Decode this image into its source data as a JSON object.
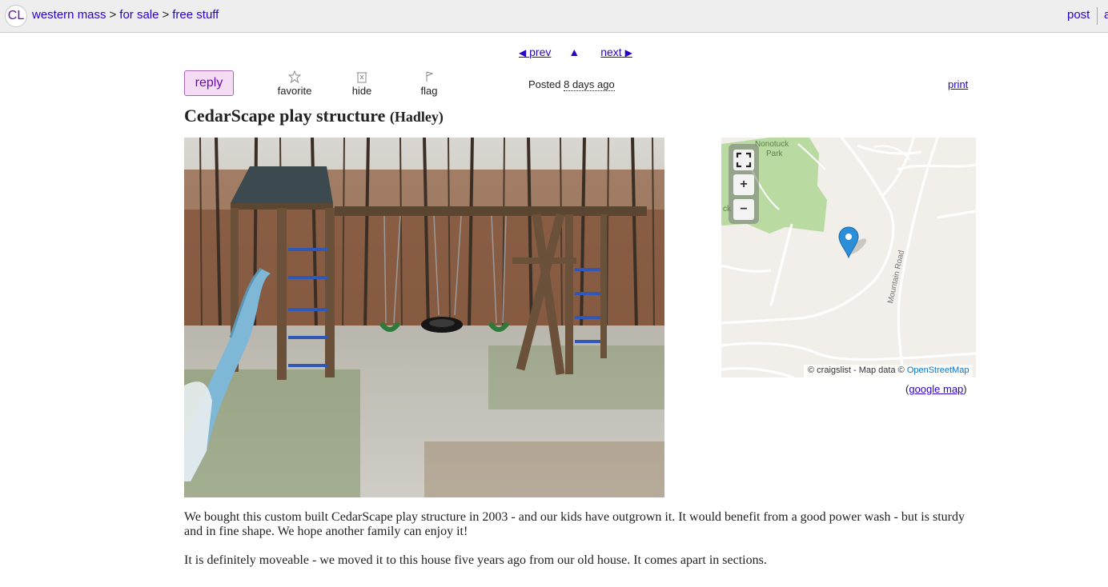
{
  "header": {
    "logo": "CL",
    "breadcrumbs": [
      "western mass",
      "for sale",
      "free stuff"
    ],
    "separator": ">",
    "post_link": "post",
    "account_link_partial": "a"
  },
  "nav": {
    "prev_label": "prev",
    "up_label": "▲",
    "next_label": "next"
  },
  "actions": {
    "reply_label": "reply",
    "favorite_label": "favorite",
    "hide_label": "hide",
    "flag_label": "flag",
    "posted_prefix": "Posted",
    "posted_when": "8 days ago",
    "print_label": "print"
  },
  "posting": {
    "title": "CedarScape play structure",
    "location": "(Hadley)",
    "paragraphs": [
      "We bought this custom built CedarScape play structure in 2003 - and our kids have outgrown it. It would benefit from a good power wash - but is sturdy and in fine shape. We hope another family can enjoy it!",
      "It is definitely moveable - we moved it to this house five years ago from our old house. It comes apart in sections."
    ]
  },
  "map": {
    "labels": {
      "park": "Nonotuck Park",
      "park_line1": "Nonotuck",
      "park_line2": "Park",
      "road": "Mountain Road",
      "left_edge": "ck"
    },
    "attribution_prefix": "© craigslist - Map data ©",
    "attribution_link": "OpenStreetMap",
    "google_map_label": "google map",
    "google_open": "(",
    "google_close": ")",
    "park_color": "#b9dba2",
    "land_color": "#f2efea",
    "pin_color": "#2a8fd8"
  },
  "colors": {
    "link": "#2a00c8",
    "reply_bg": "#f4dcf4",
    "topbar_bg": "#eeeeee"
  }
}
